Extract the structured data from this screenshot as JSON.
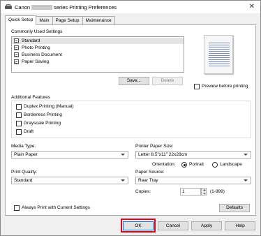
{
  "title": {
    "prefix": "Canon",
    "suffix": "series Printing Preferences",
    "close": "✕"
  },
  "tabs": [
    {
      "label": "Quick Setup"
    },
    {
      "label": "Main"
    },
    {
      "label": "Page Setup"
    },
    {
      "label": "Maintenance"
    }
  ],
  "commonly_used": {
    "heading": "Commonly Used Settings",
    "items": [
      {
        "label": "Standard",
        "icon": "standard-settings-icon"
      },
      {
        "label": "Photo Printing",
        "icon": "photo-icon"
      },
      {
        "label": "Business Document",
        "icon": "document-icon"
      },
      {
        "label": "Paper Saving",
        "icon": "paper-saving-icon"
      }
    ],
    "save_label": "Save...",
    "delete_label": "Delete"
  },
  "preview": {
    "label": "Preview before printing"
  },
  "additional": {
    "heading": "Additional Features",
    "options": [
      {
        "label": "Duplex Printing (Manual)"
      },
      {
        "label": "Borderless Printing"
      },
      {
        "label": "Grayscale Printing"
      },
      {
        "label": "Draft"
      }
    ]
  },
  "media_type": {
    "label": "Media Type:",
    "value": "Plain Paper"
  },
  "printer_paper_size": {
    "label": "Printer Paper Size:",
    "value": "Letter 8.5\"x11\" 22x28cm"
  },
  "orientation": {
    "label": "Orientation:",
    "portrait": "Portrait",
    "landscape": "Landscape"
  },
  "print_quality": {
    "label": "Print Quality:",
    "value": "Standard"
  },
  "paper_source": {
    "label": "Paper Source:",
    "value": "Rear Tray"
  },
  "copies": {
    "label": "Copies:",
    "value": "1",
    "range": "(1-999)"
  },
  "always_print": {
    "label": "Always Print with Current Settings"
  },
  "defaults_label": "Defaults",
  "footer": {
    "ok": "OK",
    "cancel": "Cancel",
    "apply": "Apply",
    "help": "Help"
  },
  "colors": {
    "highlight": "#e8001c",
    "selected_item": "#e5e5e5"
  }
}
